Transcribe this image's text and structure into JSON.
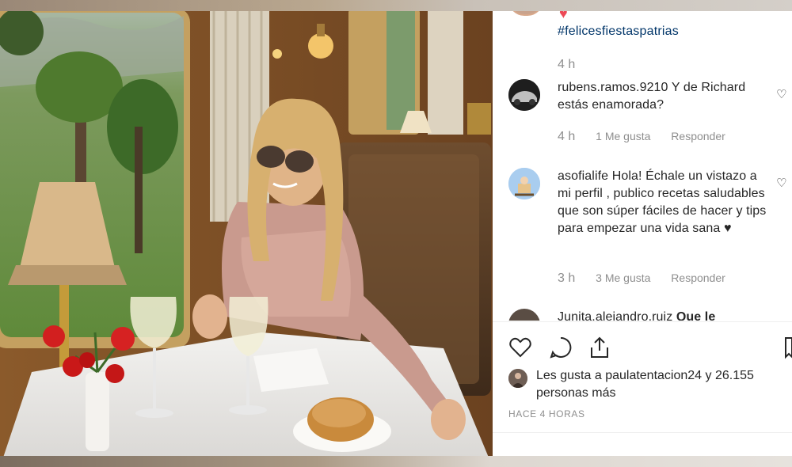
{
  "post": {
    "hashtag": "#felicesfiestaspatrias",
    "time": "4 h"
  },
  "comments": [
    {
      "username": "rubens.ramos.9210",
      "text": "Y de Richard estás enamorada?",
      "time": "4 h",
      "likes": "1 Me gusta",
      "reply": "Responder"
    },
    {
      "username": "asofialife",
      "text": "Hola! Échale un vistazo a mi perfil , publico recetas saludables que son súper fáciles de hacer y tips para empezar una vida sana ♥",
      "time": "3 h",
      "likes": "3 Me gusta",
      "reply": "Responder"
    },
    {
      "username": "Junita.alejandro.ruiz",
      "text": "Que le",
      "time": "",
      "likes": "",
      "reply": ""
    }
  ],
  "likes_summary": {
    "prefix": "Les gusta a",
    "user": "paulatentacion24",
    "suffix": "y",
    "others": "26.155 personas más"
  },
  "posted_time": "HACE 4 HORAS",
  "icons": {
    "like": "heart-outline-icon",
    "comment": "comment-icon",
    "share": "share-icon",
    "save": "bookmark-icon",
    "comment_like": "heart-outline-icon"
  },
  "colors": {
    "hashtag": "#003569",
    "secondary_text": "#8e8e8e",
    "heart_red": "#ed4956",
    "text": "#262626"
  }
}
